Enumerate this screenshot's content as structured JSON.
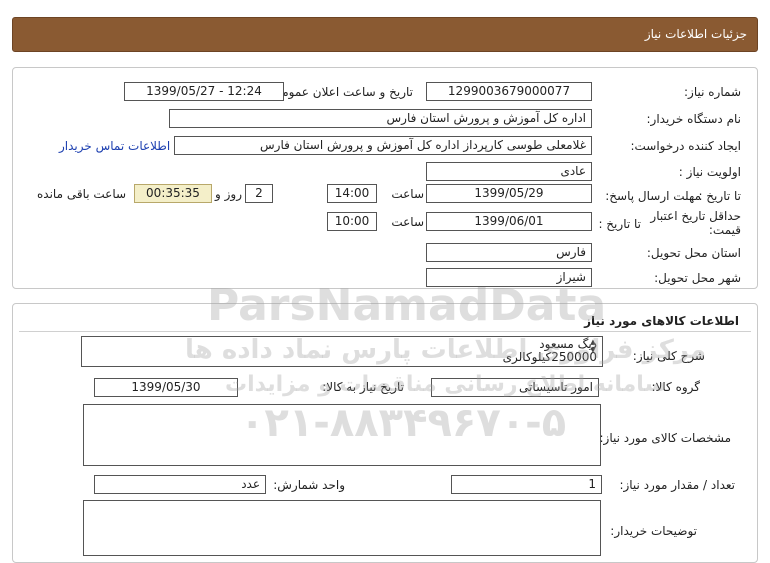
{
  "header": {
    "title": "جزئیات اطلاعات نیاز"
  },
  "info": {
    "need_number_label": "شماره نیاز:",
    "need_number": "1299003679000077",
    "announce_label": "تاریخ و ساعت اعلان عمومی:",
    "announce_value": "1399/05/27 - 12:24",
    "buyer_label": "نام دستگاه خریدار:",
    "buyer_value": "اداره کل آموزش و پرورش استان فارس",
    "creator_label": "ایجاد کننده درخواست:",
    "creator_value": "غلامعلی طوسی کارپرداز اداره کل آموزش و پرورش استان فارس",
    "contact_link": "اطلاعات تماس خریدار",
    "priority_label": "اولویت نیاز :",
    "priority_value": "عادی",
    "deadline_label": "مهلت ارسال پاسخ:",
    "to_date_label": "تا تاریخ :",
    "deadline_date": "1399/05/29",
    "time_label": "ساعت",
    "deadline_time": "14:00",
    "days_value": "2",
    "days_label": "روز و",
    "remaining_time": "00:35:35",
    "remaining_label": "ساعت باقی مانده",
    "validity_label": "حداقل تاریخ اعتبار قیمت:",
    "validity_to_label": "تا تاریخ :",
    "validity_date": "1399/06/01",
    "validity_time_label": "ساعت",
    "validity_time": "10:00",
    "province_label": "استان محل تحویل:",
    "province_value": "فارس",
    "city_label": "شهر محل تحویل:",
    "city_value": "شیراز"
  },
  "goods": {
    "section_title": "اطلاعات کالاهای مورد نیاز",
    "description_label": "شرح کلی نیاز:",
    "description_line1": "دیگ مسعود",
    "description_line2": "250000کیلوکالری",
    "group_label": "گروه کالا:",
    "group_value": "امور تاسیساتی",
    "need_date_label": "تاریخ نیاز به کالا:",
    "need_date_value": "1399/05/30",
    "specs_label": "مشخصات کالای مورد نیاز:",
    "quantity_label": "تعداد / مقدار مورد نیاز:",
    "quantity_value": "1",
    "unit_label": "واحد شمارش:",
    "unit_value": "عدد",
    "buyer_notes_label": "توضیحات خریدار:"
  },
  "watermark": {
    "line1": "ParsNamadData",
    "line2": "مرکز فراوری اطلاعات پارس نماد داده ها",
    "line3": "سامانه اطلاع رسانی مناقصات و مزایدات",
    "phone": "۰۲۱-۸۸۳۴۹۶۷۰-۵"
  }
}
